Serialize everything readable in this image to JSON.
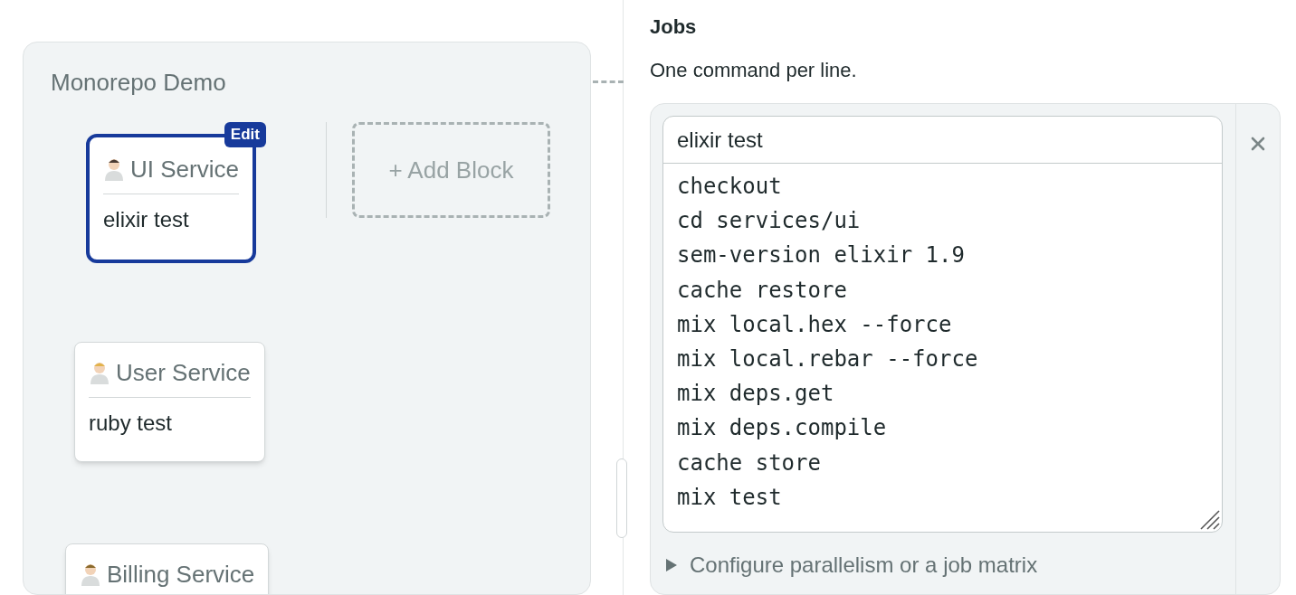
{
  "pipeline": {
    "title": "Monorepo Demo",
    "add_block": "+ Add Block",
    "blocks": [
      {
        "name": "UI Service",
        "job": "elixir test",
        "selected": true,
        "badge": "Edit"
      },
      {
        "name": "User Service",
        "job": "ruby test",
        "selected": false
      },
      {
        "name": "Billing Service",
        "selected": false
      }
    ]
  },
  "jobs_panel": {
    "title": "Jobs",
    "hint": "One command per line.",
    "job": {
      "name": "elixir test",
      "commands": [
        "checkout",
        "cd services/ui",
        "sem-version elixir 1.9",
        "cache restore",
        "mix local.hex --force",
        "mix local.rebar --force",
        "mix deps.get",
        "mix deps.compile",
        "cache store",
        "mix test"
      ]
    },
    "configure": "Configure parallelism or a job matrix"
  }
}
